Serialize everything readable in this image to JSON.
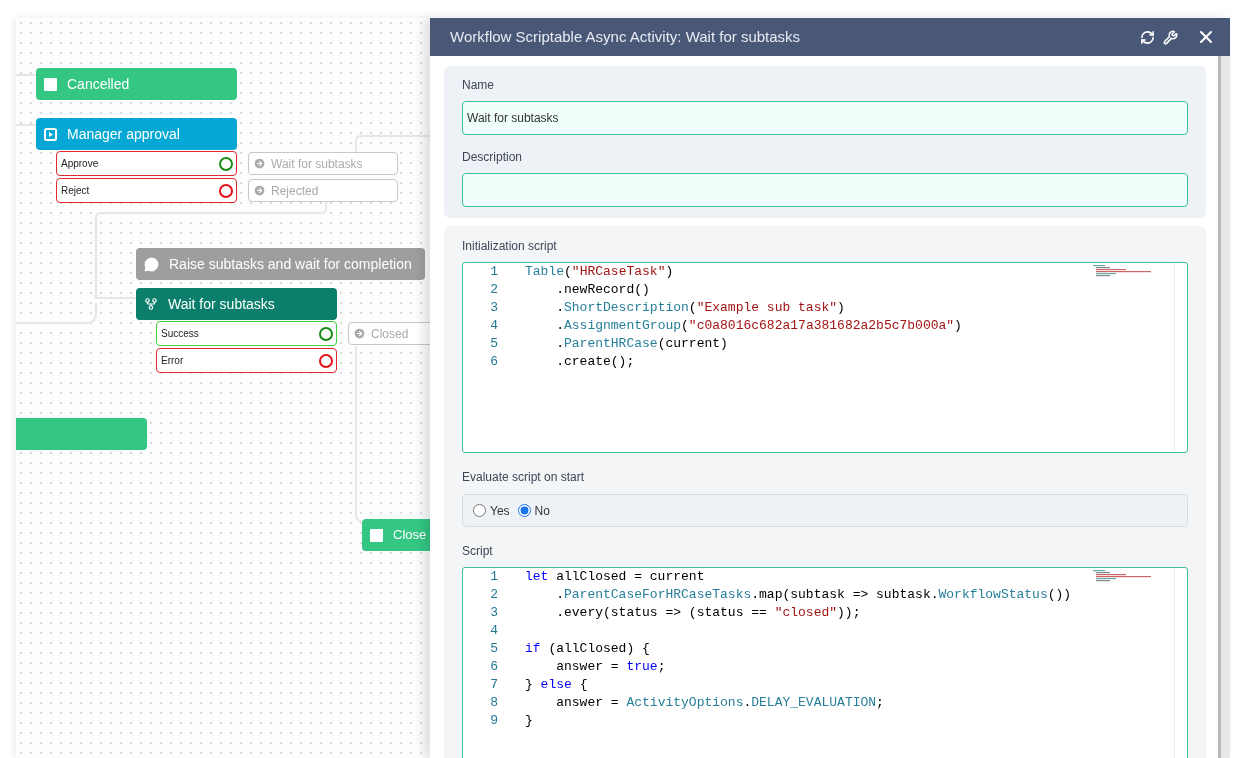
{
  "canvas": {
    "nodes": [
      {
        "kind": "end",
        "label": "Cancelled"
      },
      {
        "kind": "approval",
        "label": "Manager approval",
        "outcomes": [
          {
            "label": "Approve",
            "kind": "success",
            "highlighted": false,
            "link": "Wait for subtasks"
          },
          {
            "label": "Reject",
            "kind": "error",
            "highlighted": false,
            "link": "Rejected"
          }
        ]
      },
      {
        "kind": "comment",
        "label": "Raise subtasks and wait for completion"
      },
      {
        "kind": "async",
        "label": "Wait for subtasks",
        "outcomes": [
          {
            "label": "Success",
            "kind": "success",
            "highlighted": true,
            "link": "Closed"
          },
          {
            "label": "Error",
            "kind": "error",
            "highlighted": false
          }
        ]
      },
      {
        "kind": "end"
      },
      {
        "kind": "end",
        "label": "Close"
      }
    ]
  },
  "panel": {
    "title": "Workflow Scriptable Async Activity: Wait for subtasks",
    "fields": [
      {
        "label": "Name",
        "value": "Wait for subtasks"
      },
      {
        "label": "Description"
      }
    ],
    "initialization_script": {
      "label": "Initialization script",
      "lines": [
        {
          "no": "1",
          "tokens": [
            {
              "t": "Table",
              "color": "#267f99"
            },
            {
              "t": "("
            },
            {
              "t": "\"HRCaseTask\"",
              "color": "#a31515"
            },
            {
              "t": ")"
            }
          ]
        },
        {
          "no": "2",
          "tokens": [
            {
              "t": "    .newRecord()"
            }
          ]
        },
        {
          "no": "3",
          "tokens": [
            {
              "t": "    ."
            },
            {
              "t": "ShortDescription",
              "color": "#267f99"
            },
            {
              "t": "("
            },
            {
              "t": "\"Example sub task\"",
              "color": "#a31515"
            },
            {
              "t": ")"
            }
          ]
        },
        {
          "no": "4",
          "tokens": [
            {
              "t": "    ."
            },
            {
              "t": "AssignmentGroup",
              "color": "#267f99"
            },
            {
              "t": "("
            },
            {
              "t": "\"c0a8016c682a17a381682a2b5c7b000a\"",
              "color": "#a31515"
            },
            {
              "t": ")"
            }
          ]
        },
        {
          "no": "5",
          "tokens": [
            {
              "t": "    ."
            },
            {
              "t": "ParentHRCase",
              "color": "#267f99"
            },
            {
              "t": "(current)"
            }
          ]
        },
        {
          "no": "6",
          "tokens": [
            {
              "t": "    .create();"
            }
          ]
        }
      ]
    },
    "evaluate_on_start": {
      "label": "Evaluate script on start",
      "options": [
        {
          "label": "Yes",
          "selected": false
        },
        {
          "label": "No",
          "selected": true
        }
      ]
    },
    "script": {
      "label": "Script",
      "lines": [
        {
          "no": "1",
          "tokens": [
            {
              "t": "let",
              "color": "#0000ff"
            },
            {
              "t": " allClosed = current"
            }
          ]
        },
        {
          "no": "2",
          "tokens": [
            {
              "t": "    ."
            },
            {
              "t": "ParentCaseForHRCaseTasks",
              "color": "#267f99"
            },
            {
              "t": ".map(subtask => subtask."
            },
            {
              "t": "WorkflowStatus",
              "color": "#267f99"
            },
            {
              "t": "())"
            }
          ]
        },
        {
          "no": "3",
          "tokens": [
            {
              "t": "    .every(status => (status == "
            },
            {
              "t": "\"closed\"",
              "color": "#a31515"
            },
            {
              "t": "));"
            }
          ]
        },
        {
          "no": "4"
        },
        {
          "no": "5",
          "tokens": [
            {
              "t": "if",
              "color": "#0000ff"
            },
            {
              "t": " (allClosed) {"
            }
          ]
        },
        {
          "no": "6",
          "tokens": [
            {
              "t": "    answer = "
            },
            {
              "t": "true",
              "color": "#0000ff"
            },
            {
              "t": ";"
            }
          ]
        },
        {
          "no": "7",
          "tokens": [
            {
              "t": "} "
            },
            {
              "t": "else",
              "color": "#0000ff"
            },
            {
              "t": " {"
            }
          ]
        },
        {
          "no": "8",
          "tokens": [
            {
              "t": "    answer = "
            },
            {
              "t": "ActivityOptions",
              "color": "#267f99"
            },
            {
              "t": "."
            },
            {
              "t": "DELAY_EVALUATION",
              "color": "#267f99"
            },
            {
              "t": ";"
            }
          ]
        },
        {
          "no": "9",
          "tokens": [
            {
              "t": "}"
            }
          ]
        }
      ]
    }
  }
}
